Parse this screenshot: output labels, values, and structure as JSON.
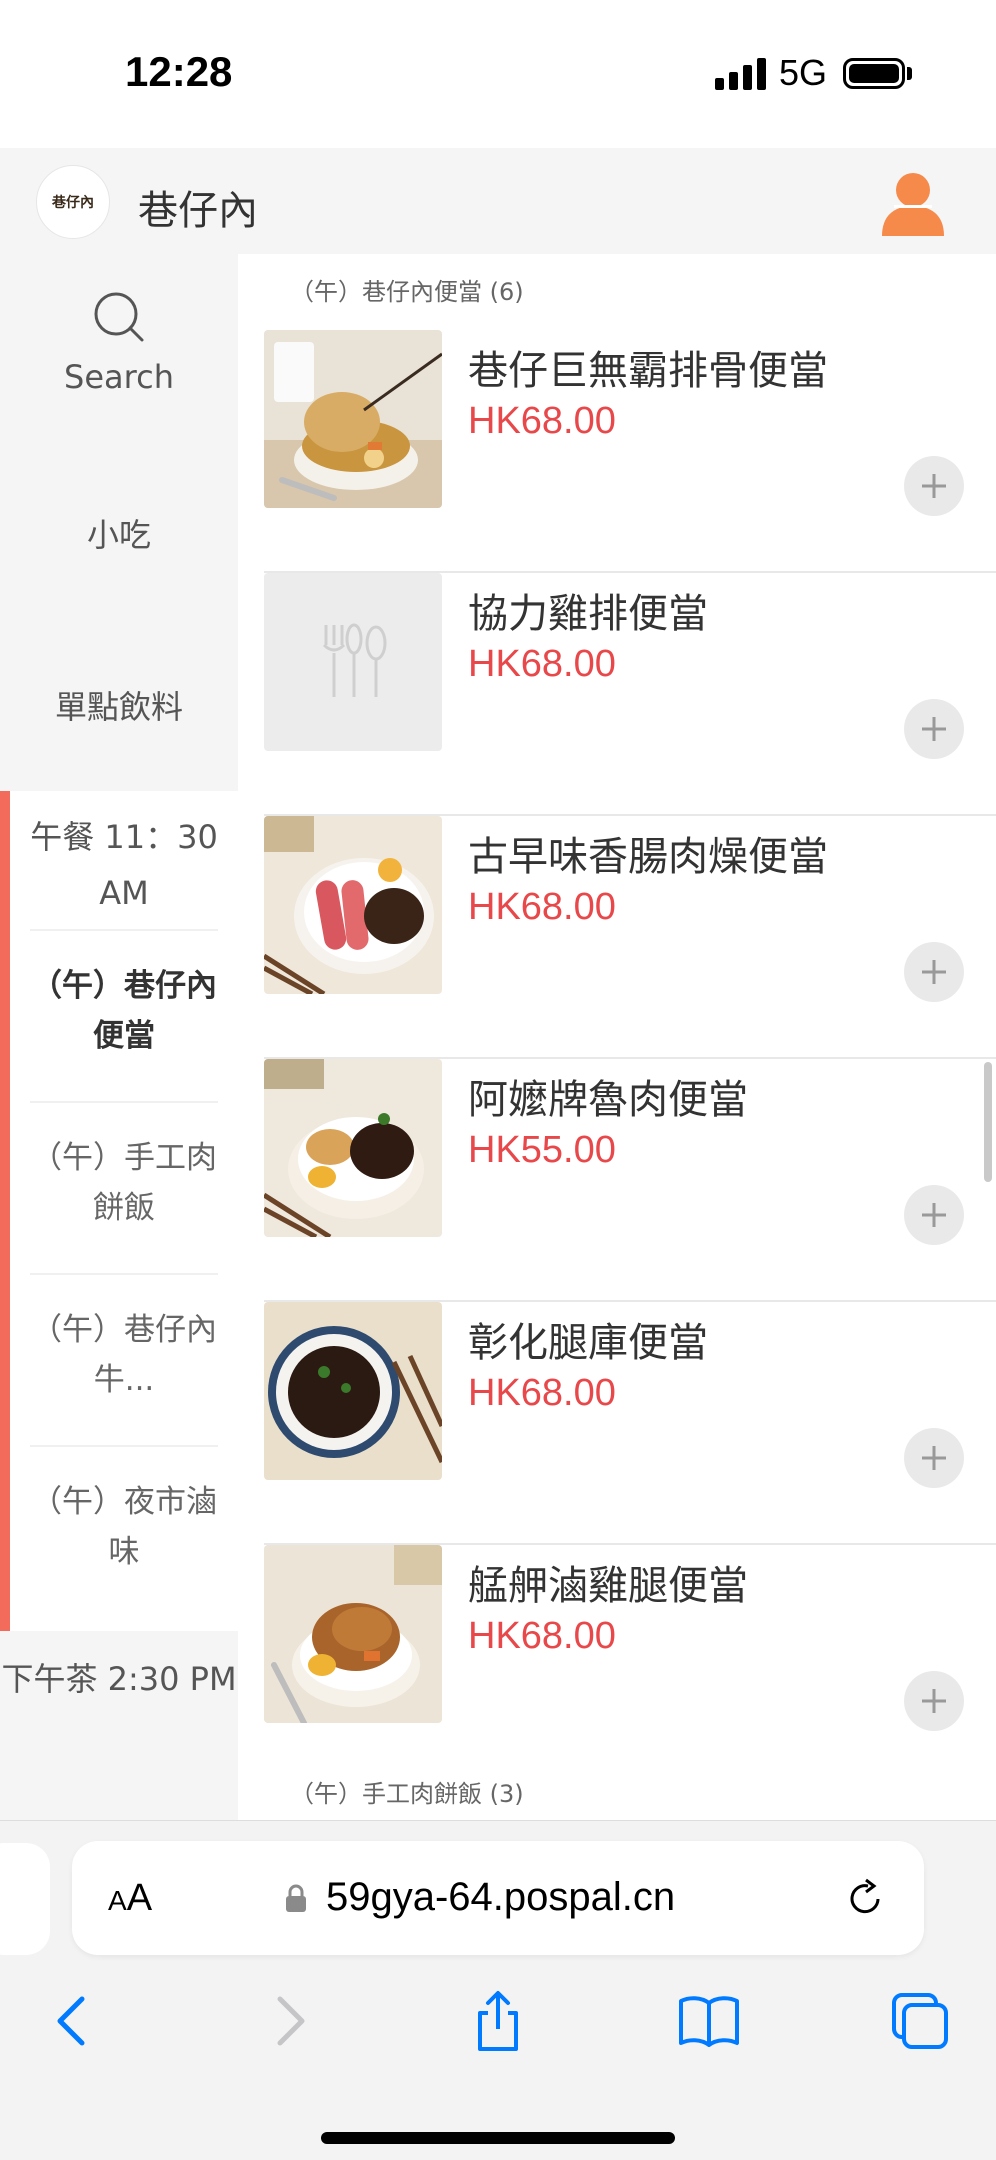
{
  "status_bar": {
    "time": "12:28",
    "network": "5G"
  },
  "header": {
    "logo_text": "巷仔內",
    "title": "巷仔內"
  },
  "sidebar": {
    "search_label": "Search",
    "categories": [
      "小吃",
      "單點飲料"
    ],
    "active_group": {
      "title": "午餐 11：30 AM",
      "items": [
        {
          "label": "（午）巷仔內便當"
        },
        {
          "label": "（午）手工肉餅飯"
        },
        {
          "label": "（午）巷仔內牛..."
        },
        {
          "label": "（午）夜市滷味"
        }
      ]
    },
    "next_group": "下午茶 2:30 PM"
  },
  "main": {
    "sections": [
      {
        "label": "（午）巷仔內便當 (6)"
      },
      {
        "label": "（午）手工肉餅飯 (3)"
      }
    ],
    "products": [
      {
        "name": "巷仔巨無霸排骨便當",
        "price": "HK68.00",
        "image": "pork-chop"
      },
      {
        "name": "協力雞排便當",
        "price": "HK68.00",
        "image": "placeholder"
      },
      {
        "name": "古早味香腸肉燥便當",
        "price": "HK68.00",
        "image": "sausage"
      },
      {
        "name": "阿嬤牌魯肉便當",
        "price": "HK55.00",
        "image": "braised-pork"
      },
      {
        "name": "彰化腿庫便當",
        "price": "HK68.00",
        "image": "pork-knuckle"
      },
      {
        "name": "艋舺滷雞腿便當",
        "price": "HK68.00",
        "image": "chicken-leg"
      }
    ]
  },
  "browser": {
    "aa_small": "A",
    "aa_big": "A",
    "url": "59gya-64.pospal.cn"
  },
  "colors": {
    "accent": "#f26b5b",
    "price": "#e8484a",
    "user_icon": "#f58a4b",
    "ios_blue": "#007aff"
  }
}
